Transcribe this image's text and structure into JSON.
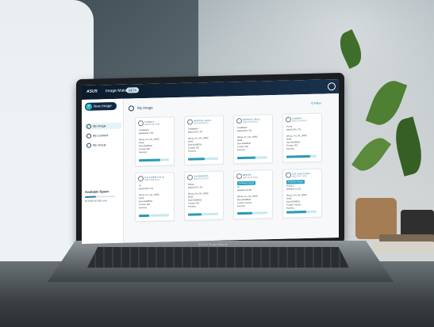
{
  "laptop": {
    "brand": "ASUS ExpertBook"
  },
  "app": {
    "brand": "ASUS",
    "name": "Image Maker",
    "badge": "BETA"
  },
  "sidebar": {
    "new_button": "New Image",
    "items": [
      {
        "label": "My Image",
        "active": true
      },
      {
        "label": "My Content",
        "active": false
      },
      {
        "label": "My Group",
        "active": false
      }
    ],
    "storage": {
      "label": "Available Space",
      "text": "53.5GB/140.8GB used",
      "fraction": 0.38
    }
  },
  "main": {
    "title": "My Image",
    "filter": "Filter"
  },
  "cards": [
    {
      "name": "TestBatch...",
      "date": "2022-05-20 15:08",
      "lines": [
        "TestMaster",
        "Beta/1234 1 TB",
        "",
        "Win11_Pro_64_19092",
        "20H2",
        "Size:4GB/8GB",
        "Format: ISO",
        "Running"
      ],
      "progress": 0.72,
      "tag": ""
    },
    {
      "name": "BH45C5A_Win11...",
      "date": "2022-04-03 09:21",
      "lines": [
        "TestMaster",
        "Beta/1234 1 TB",
        "",
        "Win11_Pro_64_19092",
        "20H2",
        "Size:4GB/8GB",
        "Format: ISO",
        "Running"
      ],
      "progress": 0.55,
      "tag": ""
    },
    {
      "name": "BH45C5A_Win11...",
      "date": "2022-04-01 09:21",
      "lines": [
        "TestMaster",
        "Beta/1234 1 TB",
        "",
        "Win11_Pro_64_19092",
        "20H2",
        "Size:4GB/8GB",
        "Format: ISO",
        "Running"
      ],
      "progress": 0.6,
      "tag": ""
    },
    {
      "name": "TestBuffer",
      "date": "2022-03-14 09:21",
      "lines": [
        "Group",
        "Beta/1234 1 TB",
        "",
        "Win11_Pro_64_19092",
        "20H2",
        "Size:4GB/8GB",
        "Format: ISO",
        "Running"
      ],
      "progress": 0.8,
      "tag": ""
    },
    {
      "name": "Test 123456 Test_B...",
      "date": "2022-03-08 19:21",
      "lines": [
        "ID",
        "Beta/1234 1 TB",
        "",
        "Win11_Pro_64_19092",
        "20H2",
        "Size:4GB/8GB",
        "Format: ISO",
        "Running"
      ],
      "progress": 0.35,
      "tag": ""
    },
    {
      "name": "Test BH45C5A",
      "date": "2022-02-16 10:21",
      "lines": [
        "testing",
        "Beta/1234 1 TB",
        "",
        "Win11_Pro_64_19092",
        "20H2",
        "Size:4GB/8GB",
        "Format: ISO",
        "Pending"
      ],
      "progress": 0.45,
      "tag": ""
    },
    {
      "name": "B8S9H5",
      "date": "2022-01-25 16:21",
      "lines": [
        "ID",
        "Beta/BH, 1C1B",
        "",
        "Win11_Pro_64_19092",
        "Size:4GB/8GB",
        "Format: Factory",
        "Running"
      ],
      "progress": 0.5,
      "tag": "Production Ready"
    },
    {
      "name": "Test_Dash-beta01...",
      "date": "2022-01-07 19:04",
      "lines": [
        "Group 1",
        "Beta/BH, 1C1B",
        "",
        "Win11_Pro_64_19092",
        "20H2",
        "Size:4GB/8GB",
        "Format: Factory",
        "Running"
      ],
      "progress": 0.65,
      "tag": "Production Ready"
    }
  ]
}
